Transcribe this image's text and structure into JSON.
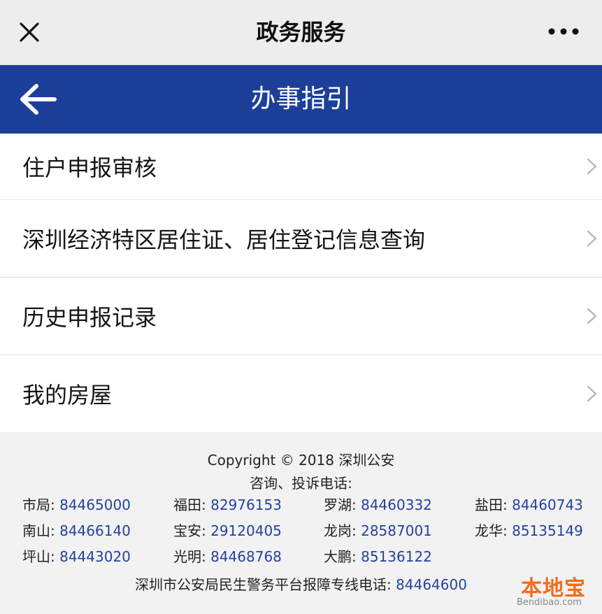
{
  "topbar": {
    "title": "政务服务",
    "close_icon": "close-icon",
    "more_icon": "more-dots-icon"
  },
  "navbar": {
    "title": "办事指引",
    "back_icon": "back-arrow-icon",
    "background": "#1c3f9a"
  },
  "menu": {
    "items": [
      {
        "label": "住户申报审核"
      },
      {
        "label": "深圳经济特区居住证、居住登记信息查询"
      },
      {
        "label": "历史申报记录"
      },
      {
        "label": "我的房屋"
      }
    ]
  },
  "footer": {
    "copyright": "Copyright © 2018 深圳公安",
    "consult": "咨询、投诉电话:",
    "phones": [
      [
        {
          "area": "市局:",
          "number": "84465000"
        },
        {
          "area": "福田:",
          "number": "82976153"
        },
        {
          "area": "罗湖:",
          "number": "84460332"
        },
        {
          "area": "盐田:",
          "number": "84460743"
        }
      ],
      [
        {
          "area": "南山:",
          "number": "84466140"
        },
        {
          "area": "宝安:",
          "number": "29120405"
        },
        {
          "area": "龙岗:",
          "number": "28587001"
        },
        {
          "area": "龙华:",
          "number": "85135149"
        }
      ],
      [
        {
          "area": "坪山:",
          "number": "84443020"
        },
        {
          "area": "光明:",
          "number": "84468768"
        },
        {
          "area": "大鹏:",
          "number": "85136122"
        }
      ]
    ],
    "hotline_label": "深圳市公安局民生警务平台报障专线电话:",
    "hotline_number": "84464600",
    "link_color": "#24429c"
  },
  "watermark": {
    "text": "本地宝",
    "domain": "Bendibao.com"
  }
}
